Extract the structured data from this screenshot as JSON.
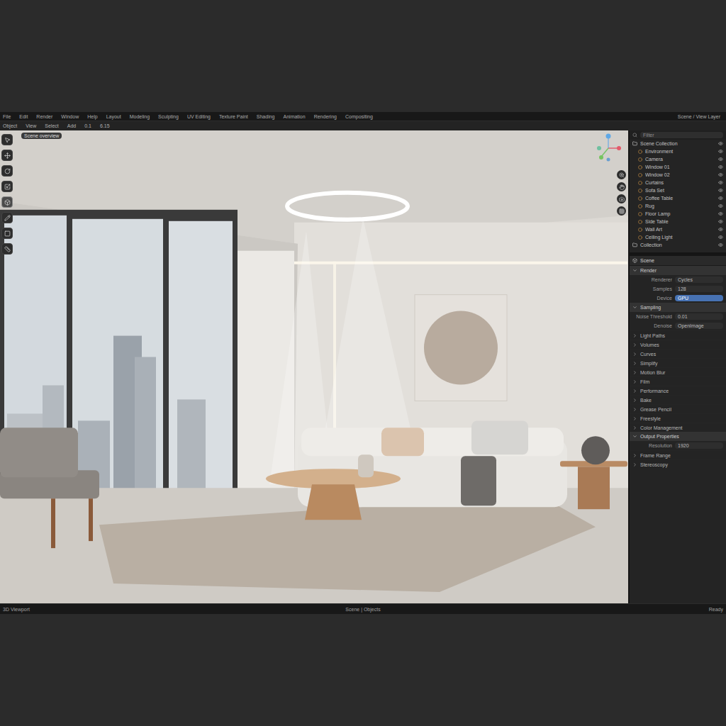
{
  "menu": [
    "File",
    "Edit",
    "Render",
    "Window",
    "Help",
    "Layout",
    "Modeling",
    "Sculpting",
    "UV Editing",
    "Texture Paint",
    "Shading",
    "Animation",
    "Rendering",
    "Compositing"
  ],
  "menu_right": "Scene / View Layer",
  "toolbar": {
    "items": [
      "Object",
      "View",
      "Select",
      "Add",
      "0.1",
      "6.15"
    ]
  },
  "viewport": {
    "label": "Scene overview"
  },
  "tools": [
    {
      "selected": false
    },
    {
      "selected": false
    },
    {
      "selected": false
    },
    {
      "selected": false
    },
    {
      "selected": true
    },
    {
      "selected": false
    },
    {
      "selected": false
    },
    {
      "selected": false
    }
  ],
  "outliner": {
    "search": "Filter",
    "items": [
      {
        "label": "Scene Collection",
        "kind": "collection"
      },
      {
        "label": "Environment",
        "kind": "object"
      },
      {
        "label": "Camera",
        "kind": "object"
      },
      {
        "label": "Window 01",
        "kind": "object"
      },
      {
        "label": "Window 02",
        "kind": "object"
      },
      {
        "label": "Curtains",
        "kind": "object"
      },
      {
        "label": "Sofa Set",
        "kind": "object"
      },
      {
        "label": "Coffee Table",
        "kind": "object"
      },
      {
        "label": "Rug",
        "kind": "object"
      },
      {
        "label": "Floor Lamp",
        "kind": "object"
      },
      {
        "label": "Side Table",
        "kind": "object"
      },
      {
        "label": "Wall Art",
        "kind": "object"
      },
      {
        "label": "Ceiling Light",
        "kind": "object"
      },
      {
        "label": "Collection",
        "kind": "collection"
      }
    ]
  },
  "properties": {
    "title": "Scene",
    "rows": [
      {
        "kind": "header",
        "label": "Render"
      },
      {
        "kind": "field",
        "label": "Renderer",
        "value": "Cycles",
        "selected": false
      },
      {
        "kind": "field",
        "label": "Samples",
        "value": "128",
        "selected": false
      },
      {
        "kind": "field",
        "label": "Device",
        "value": "GPU",
        "selected": true
      },
      {
        "kind": "header",
        "label": "Sampling"
      },
      {
        "kind": "field",
        "label": "Noise Threshold",
        "value": "0.01",
        "selected": false
      },
      {
        "kind": "field",
        "label": "Denoise",
        "value": "OpenImage",
        "selected": false
      },
      {
        "kind": "item",
        "label": "Light Paths"
      },
      {
        "kind": "item",
        "label": "Volumes"
      },
      {
        "kind": "item",
        "label": "Curves"
      },
      {
        "kind": "item",
        "label": "Simplify"
      },
      {
        "kind": "item",
        "label": "Motion Blur"
      },
      {
        "kind": "item",
        "label": "Film"
      },
      {
        "kind": "item",
        "label": "Performance"
      },
      {
        "kind": "item",
        "label": "Bake"
      },
      {
        "kind": "item",
        "label": "Grease Pencil"
      },
      {
        "kind": "item",
        "label": "Freestyle"
      },
      {
        "kind": "item",
        "label": "Color Management"
      },
      {
        "kind": "header",
        "label": "Output Properties"
      },
      {
        "kind": "field",
        "label": "Resolution",
        "value": "1920",
        "selected": false
      },
      {
        "kind": "item",
        "label": "Frame Range"
      },
      {
        "kind": "item",
        "label": "Stereoscopy"
      }
    ]
  },
  "status_bar": {
    "left": "3D Viewport",
    "center": "Scene | Objects",
    "right": "Ready"
  }
}
